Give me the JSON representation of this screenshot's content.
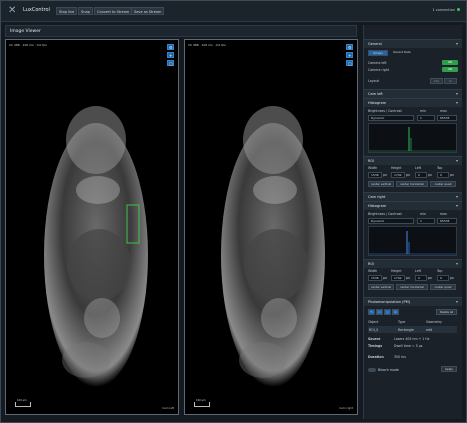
{
  "app": {
    "logo": "✕",
    "title": "LuxControl"
  },
  "toolbar": {
    "buttons": [
      "Stop live",
      "Snap",
      "Convert to Stream",
      "Save as Stream"
    ],
    "status": "1 connection"
  },
  "viewer": {
    "title": "Image Viewer",
    "left": {
      "info": "Ch 488 · 100 ms · 0.0 fps",
      "scale": "100 µm",
      "cam": "Cam left"
    },
    "right": {
      "info": "Ch 488 · 100 ms · 0.0 fps",
      "scale": "100 µm",
      "cam": "Cam right"
    }
  },
  "panel": {
    "general": "General",
    "tabs": [
      "Screen",
      "Recent Data"
    ],
    "camera_left": "Camera left",
    "camera_right": "Camera right",
    "layout": "Layout",
    "cam_left_sec": "Cam left",
    "histogram": "Histogram",
    "bc": "Brightness / Contrast",
    "min": "min",
    "max": "max",
    "mode": "Dynamic",
    "min_val": "1",
    "max_val": "65535",
    "roi": "ROI",
    "width": "Width",
    "height": "Height",
    "left": "Left",
    "top": "Top",
    "w_val": "1536",
    "h_val": "1792",
    "l_val": "0",
    "t_val": "0",
    "px": "px",
    "center_v": "center vertical",
    "center_h": "center horizontal",
    "center_q": "center quad",
    "cam_right_sec": "Cam right",
    "photo": "Photomanipulation (PM)",
    "cols": [
      "Object",
      "Type",
      "Geometry"
    ],
    "row": [
      "ROI_0",
      "Rectangle",
      "edit"
    ],
    "details": [
      {
        "k": "Source",
        "v": "Lasers 405 nm + 1 Hz"
      },
      {
        "k": "Timings",
        "v": "Dwell time = 5 µs"
      },
      {
        "k": "Duration",
        "v": "350 ms"
      }
    ],
    "delete_all": "Delete all",
    "bleach": "Bleach mode",
    "apply": "Apply"
  },
  "colors": {
    "accent": "#2266aa",
    "green": "#2e9e4a",
    "roi": "#42c04a",
    "hist_left": "#2f9e55",
    "hist_right": "#3a78d0"
  }
}
